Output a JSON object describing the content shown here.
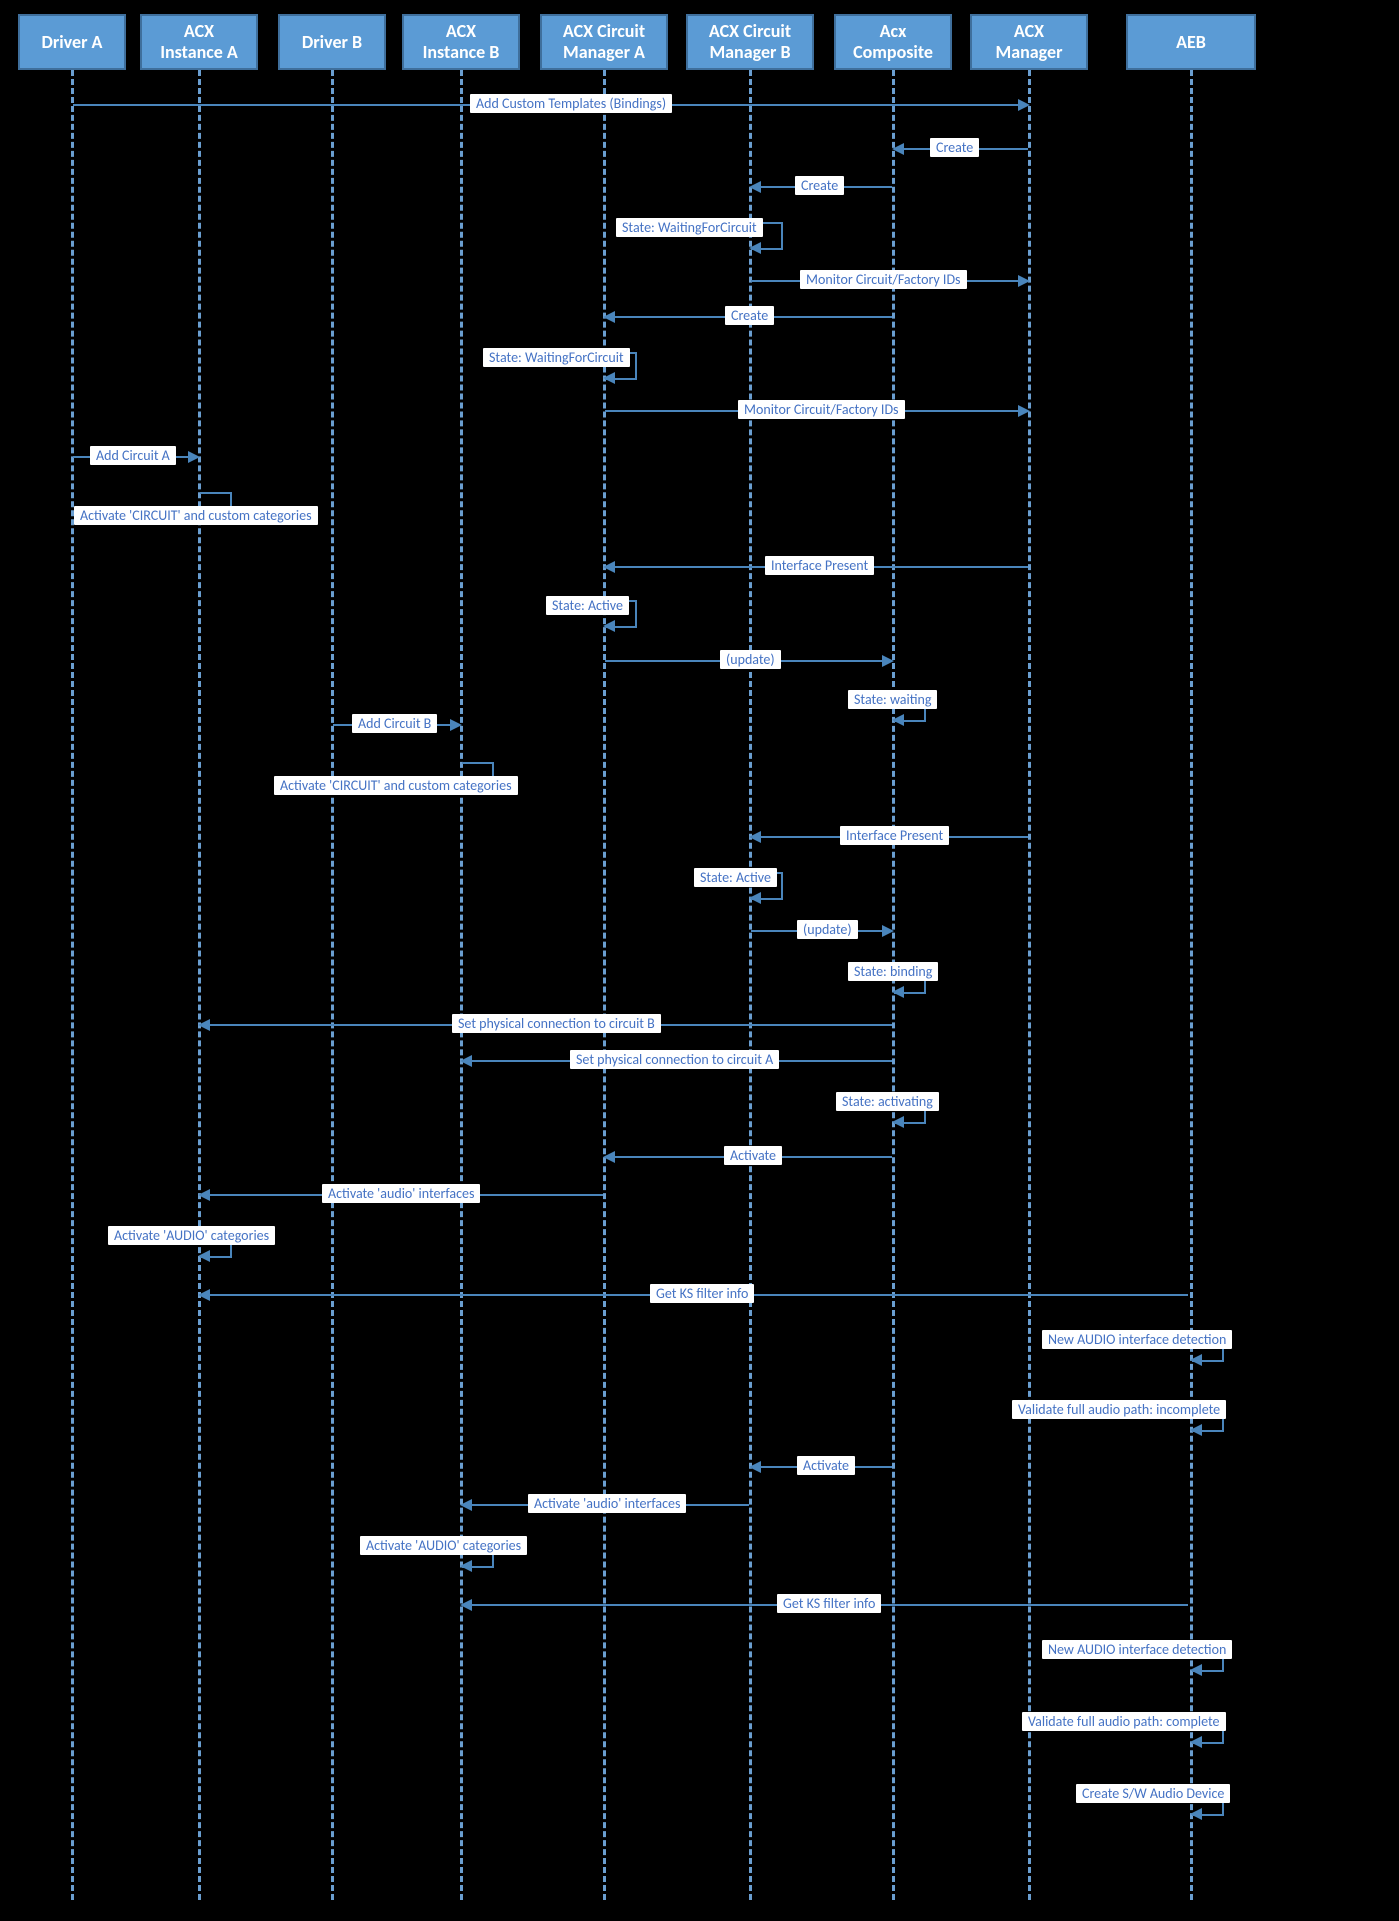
{
  "participants": {
    "p0": "Driver A",
    "p1": "ACX\nInstance A",
    "p2": "Driver B",
    "p3": "ACX\nInstance B",
    "p4": "ACX Circuit\nManager A",
    "p5": "ACX Circuit\nManager B",
    "p6": "Acx\nComposite",
    "p7": "ACX\nManager",
    "p8": "AEB"
  },
  "messages": {
    "m_add_templates": "Add Custom Templates (Bindings)",
    "m_create1": "Create",
    "m_create2": "Create",
    "m_state_wait_b": "State: WaitingForCircuit",
    "m_monitor1": "Monitor Circuit/Factory IDs",
    "m_create3": "Create",
    "m_state_wait_a": "State: WaitingForCircuit",
    "m_monitor2": "Monitor Circuit/Factory IDs",
    "m_add_circ_a": "Add Circuit A",
    "m_activate_cust_a": "Activate 'CIRCUIT' and custom categories",
    "m_ifpresent_a": "Interface Present",
    "m_state_active_a": "State: Active",
    "m_update1": "(update)",
    "m_state_waiting": "State: waiting",
    "m_add_circ_b": "Add Circuit B",
    "m_activate_cust_b": "Activate 'CIRCUIT' and custom categories",
    "m_ifpresent_b": "Interface Present",
    "m_state_active_b": "State: Active",
    "m_update2": "(update)",
    "m_state_binding": "State: binding",
    "m_set_phys_b": "Set physical connection to circuit B",
    "m_set_phys_a": "Set physical connection to circuit A",
    "m_state_activating": "State: activating",
    "m_activate1": "Activate",
    "m_activate_audio_a": "Activate 'audio' interfaces",
    "m_audio_cat_a": "Activate 'AUDIO' categories",
    "m_get_ks_a": "Get KS  filter info",
    "m_new_audio_a": "New AUDIO interface detection",
    "m_validate_inc": "Validate full audio path: incomplete",
    "m_activate2": "Activate",
    "m_activate_audio_b": "Activate 'audio' interfaces",
    "m_audio_cat_b": "Activate 'AUDIO' categories",
    "m_get_ks_b": "Get KS filter info",
    "m_new_audio_b": "New AUDIO interface detection",
    "m_validate_comp": "Validate full audio path: complete",
    "m_create_sw": "Create S/W Audio Device"
  }
}
